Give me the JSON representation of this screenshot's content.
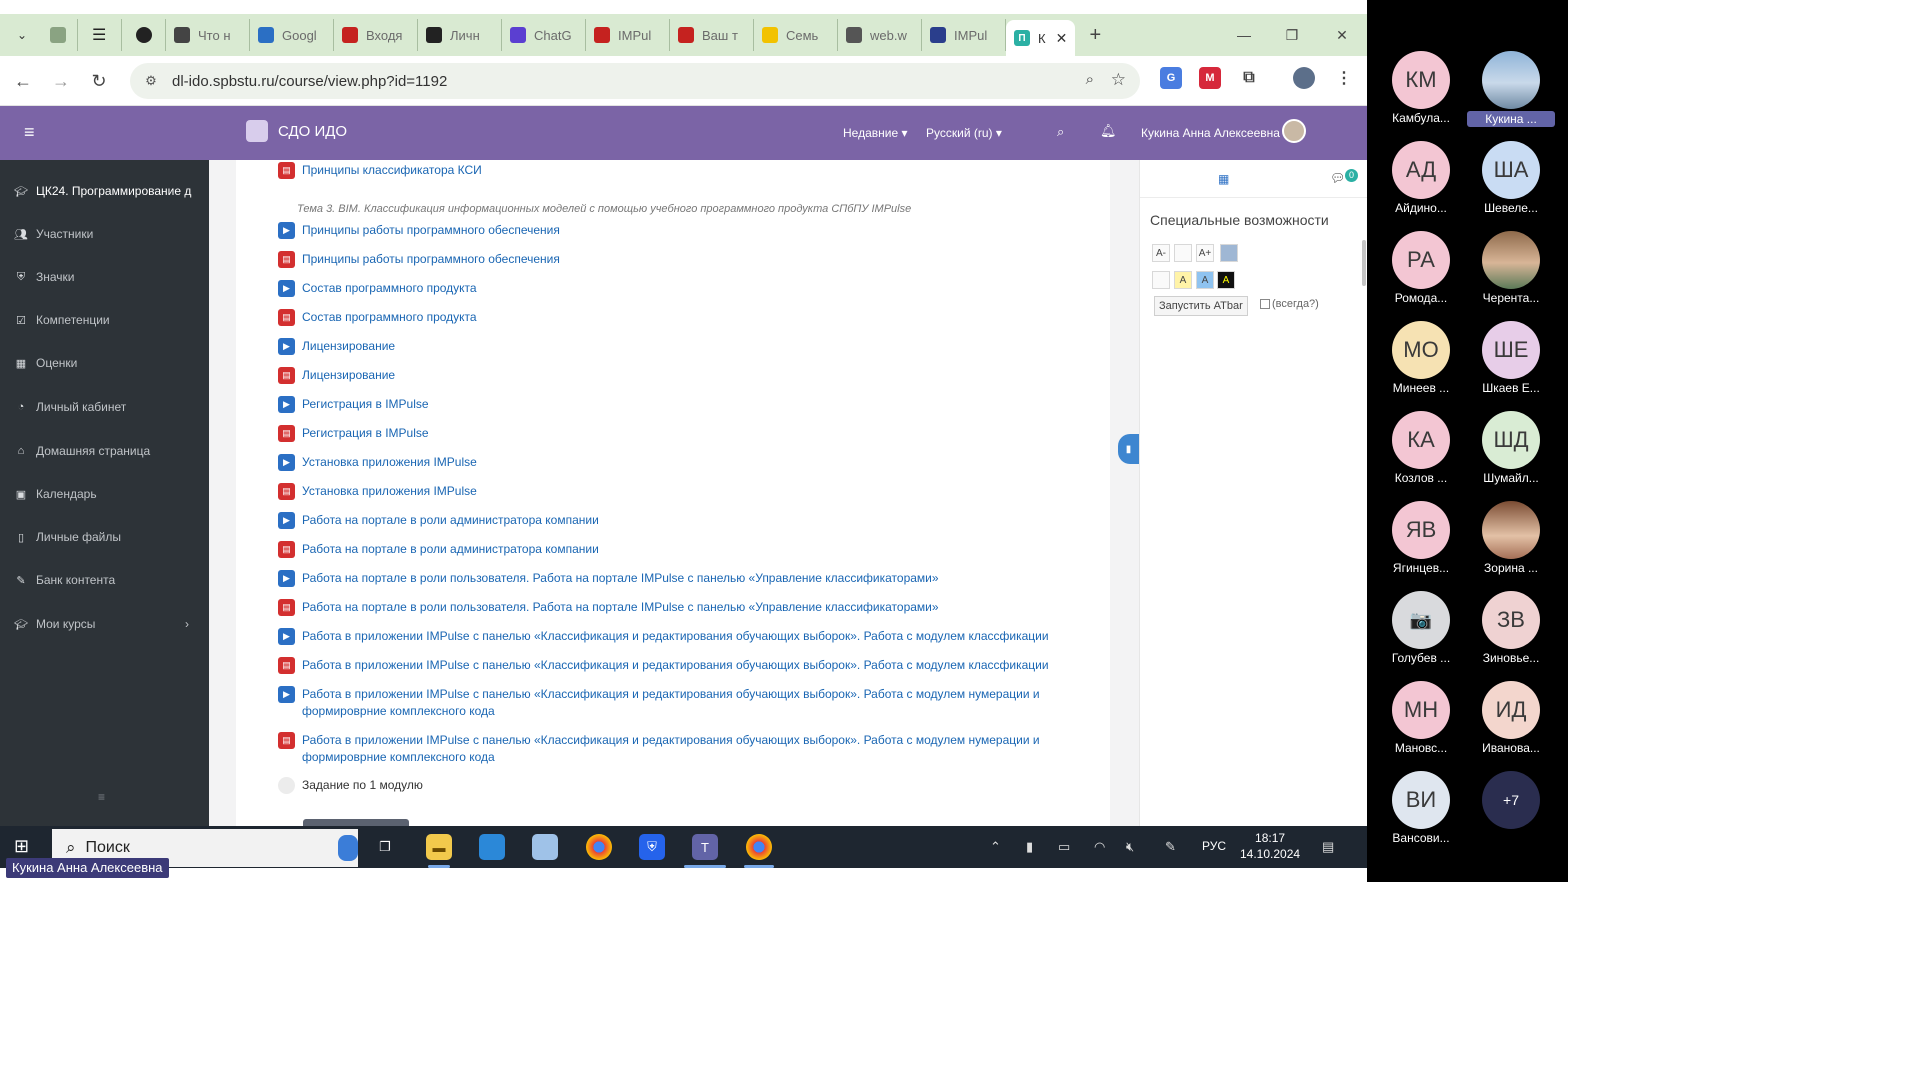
{
  "browser": {
    "tabs": [
      {
        "label": "Что н",
        "icon": "chatgpt-icon",
        "color": "#444444"
      },
      {
        "label": "Googl",
        "icon": "calendar-icon",
        "color": "#2b6fc4"
      },
      {
        "label": "Входя",
        "icon": "gmail-icon",
        "color": "#c5221f"
      },
      {
        "label": "Личн",
        "icon": "l-icon",
        "color": "#222222"
      },
      {
        "label": "ChatG",
        "icon": "s-icon",
        "color": "#5b3fd1"
      },
      {
        "label": "IMPul",
        "icon": "gmail-icon",
        "color": "#c5221f"
      },
      {
        "label": "Ваш т",
        "icon": "gmail-icon",
        "color": "#c5221f"
      },
      {
        "label": "Семь",
        "icon": "yandex-icon",
        "color": "#f2c200"
      },
      {
        "label": "web.w",
        "icon": "whatsapp-icon",
        "color": "#555555"
      },
      {
        "label": "IMPul",
        "icon": "impulse-icon",
        "color": "#2a3e8c"
      }
    ],
    "active_tab": {
      "label": "К",
      "icon": "moodle-icon",
      "color": "#2bb0a4"
    },
    "url": "dl-ido.spbstu.ru/course/view.php?id=1192"
  },
  "moodle": {
    "brand": "СДО ИДО",
    "menu_recent": "Недавние ▾",
    "menu_lang": "Русский (ru) ▾",
    "user_name": "Кукина Анна Алексеевна",
    "sidebar": [
      {
        "label": "ЦК24. Программирование д",
        "icon": "graduation-cap-icon"
      },
      {
        "label": "Участники",
        "icon": "users-icon"
      },
      {
        "label": "Значки",
        "icon": "shield-icon"
      },
      {
        "label": "Компетенции",
        "icon": "checkbox-icon"
      },
      {
        "label": "Оценки",
        "icon": "table-icon"
      },
      {
        "label": "Личный кабинет",
        "icon": "dashboard-icon"
      },
      {
        "label": "Домашняя страница",
        "icon": "home-icon"
      },
      {
        "label": "Календарь",
        "icon": "calendar-icon"
      },
      {
        "label": "Личные файлы",
        "icon": "file-icon"
      },
      {
        "label": "Банк контента",
        "icon": "pencil-icon"
      },
      {
        "label": "Мои курсы",
        "icon": "graduation-cap-icon"
      }
    ],
    "sidebar_bottom": "≡",
    "topic_label": "Тема 3. BIM. Классификация информационных моделей с помощью учебного программного продукта СПбПУ IMPulse",
    "activities": [
      {
        "type": "pdf",
        "label": "Принципы классификатора КСИ"
      },
      {
        "type": "vid",
        "label": "Принципы работы программного обеспечения"
      },
      {
        "type": "pdf",
        "label": "Принципы работы программного обеспечения"
      },
      {
        "type": "vid",
        "label": "Состав программного продукта"
      },
      {
        "type": "pdf",
        "label": "Состав программного продукта"
      },
      {
        "type": "vid",
        "label": "Лицензирование"
      },
      {
        "type": "pdf",
        "label": " Лицензирование"
      },
      {
        "type": "vid",
        "label": "Регистрация в IMPulse"
      },
      {
        "type": "pdf",
        "label": "Регистрация в IMPulse"
      },
      {
        "type": "vid",
        "label": "Установка приложения IMPulse"
      },
      {
        "type": "pdf",
        "label": "Установка приложения IMPulse"
      },
      {
        "type": "vid",
        "label": "Работа на портале в роли администратора компании"
      },
      {
        "type": "pdf",
        "label": "Работа на портале в роли администратора компании"
      },
      {
        "type": "vid",
        "label": "Работа на портале в роли пользователя. Работа на портале IMPulse с панелью «Управление классификаторами»"
      },
      {
        "type": "pdf",
        "label": "Работа на портале в роли пользователя. Работа на портале IMPulse с панелью «Управление классификаторами»"
      },
      {
        "type": "vid",
        "label": "Работа в приложении IMPulse с панелью «Классификация и редактирования обучающих выборок». Работа с модулем классфикации"
      },
      {
        "type": "pdf",
        "label": "Работа в приложении IMPulse с панелью «Классификация и редактирования обучающих выборок». Работа с модулем классфикации"
      },
      {
        "type": "vid",
        "label": "Работа в приложении IMPulse с панелью «Классификация и редактирования обучающих выборок». Работа с модулем нумерации и формироврние комплексного кода"
      },
      {
        "type": "pdf",
        "label": "Работа в приложении IMPulse с панелью «Классификация и редактирования обучающих выборок». Работа с модулем нумерации и формироврние комплексного кода"
      },
      {
        "type": "asg",
        "label": "Задание по 1 модулю"
      }
    ],
    "drawer": {
      "chat_count": "0",
      "title": "Специальные возможности",
      "font_buttons": [
        "A-",
        "",
        "A+"
      ],
      "color_buttons": [
        "",
        "A",
        "A",
        "A"
      ],
      "launch_label": "Запустить ATbar",
      "always_label": "(всегда?)"
    }
  },
  "taskbar": {
    "search_placeholder": "Поиск",
    "lang": "РУС",
    "time": "18:17",
    "date": "14.10.2024"
  },
  "presenter_label": "Кукина Анна Алексеевна",
  "participants": [
    {
      "initials": "КМ",
      "name": "Камбула...",
      "color": "#f3c6d3",
      "photo": ""
    },
    {
      "initials": "",
      "name": "Кукина ...",
      "color": "",
      "photo": "photo1",
      "highlight": true
    },
    {
      "initials": "АД",
      "name": "Айдино...",
      "color": "#f3c6d3",
      "photo": ""
    },
    {
      "initials": "ША",
      "name": "Шевеле...",
      "color": "#c9dcf3",
      "photo": ""
    },
    {
      "initials": "РА",
      "name": "Ромода...",
      "color": "#f3c6d3",
      "photo": ""
    },
    {
      "initials": "",
      "name": "Черента...",
      "color": "",
      "photo": "photo2"
    },
    {
      "initials": "МО",
      "name": "Минеев ...",
      "color": "#f6e2b3",
      "photo": ""
    },
    {
      "initials": "ШЕ",
      "name": "Шкаев Е...",
      "color": "#e7cde8",
      "photo": ""
    },
    {
      "initials": "КА",
      "name": "Козлов ...",
      "color": "#f3c6d3",
      "photo": ""
    },
    {
      "initials": "ШД",
      "name": "Шумайл...",
      "color": "#d9ecd4",
      "photo": ""
    },
    {
      "initials": "ЯВ",
      "name": "Ягинцев...",
      "color": "#f3c6d3",
      "photo": ""
    },
    {
      "initials": "",
      "name": "Зорина ...",
      "color": "",
      "photo": "photo3"
    },
    {
      "initials": "📷",
      "name": "Голубев ...",
      "color": "",
      "photo": "cam"
    },
    {
      "initials": "ЗВ",
      "name": "Зиновье...",
      "color": "#efd2d2",
      "photo": ""
    },
    {
      "initials": "МН",
      "name": "Мановс...",
      "color": "#f3c6d3",
      "photo": ""
    },
    {
      "initials": "ИД",
      "name": "Иванова...",
      "color": "#f3d6cd",
      "photo": ""
    },
    {
      "initials": "ВИ",
      "name": "Вансови...",
      "color": "#dfe6ef",
      "photo": ""
    },
    {
      "initials": "+7",
      "name": "",
      "color": "",
      "photo": "more"
    }
  ]
}
